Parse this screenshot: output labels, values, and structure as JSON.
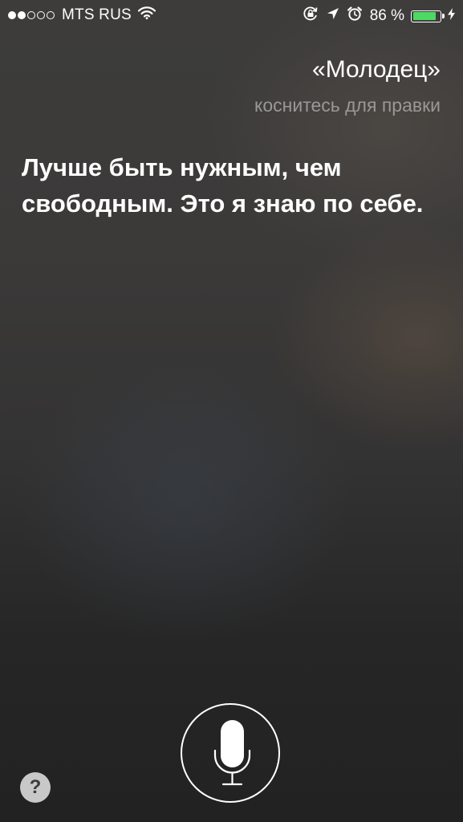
{
  "status_bar": {
    "signal_full_dots": 2,
    "signal_total_dots": 5,
    "carrier": "MTS RUS",
    "icons": [
      "wifi-icon",
      "rotation-lock-icon",
      "location-arrow-icon",
      "alarm-icon"
    ],
    "battery_percent": "86 %",
    "battery_level": 0.86,
    "battery_color": "#4cd964",
    "charging_icon": "bolt-icon"
  },
  "siri": {
    "query": "«Молодец»",
    "tap_to_edit": "коснитесь для правки",
    "answer": "Лучше быть нужным, чем свободным. Это я знаю по себе."
  },
  "controls": {
    "mic_icon": "microphone-icon",
    "help_label": "?"
  }
}
